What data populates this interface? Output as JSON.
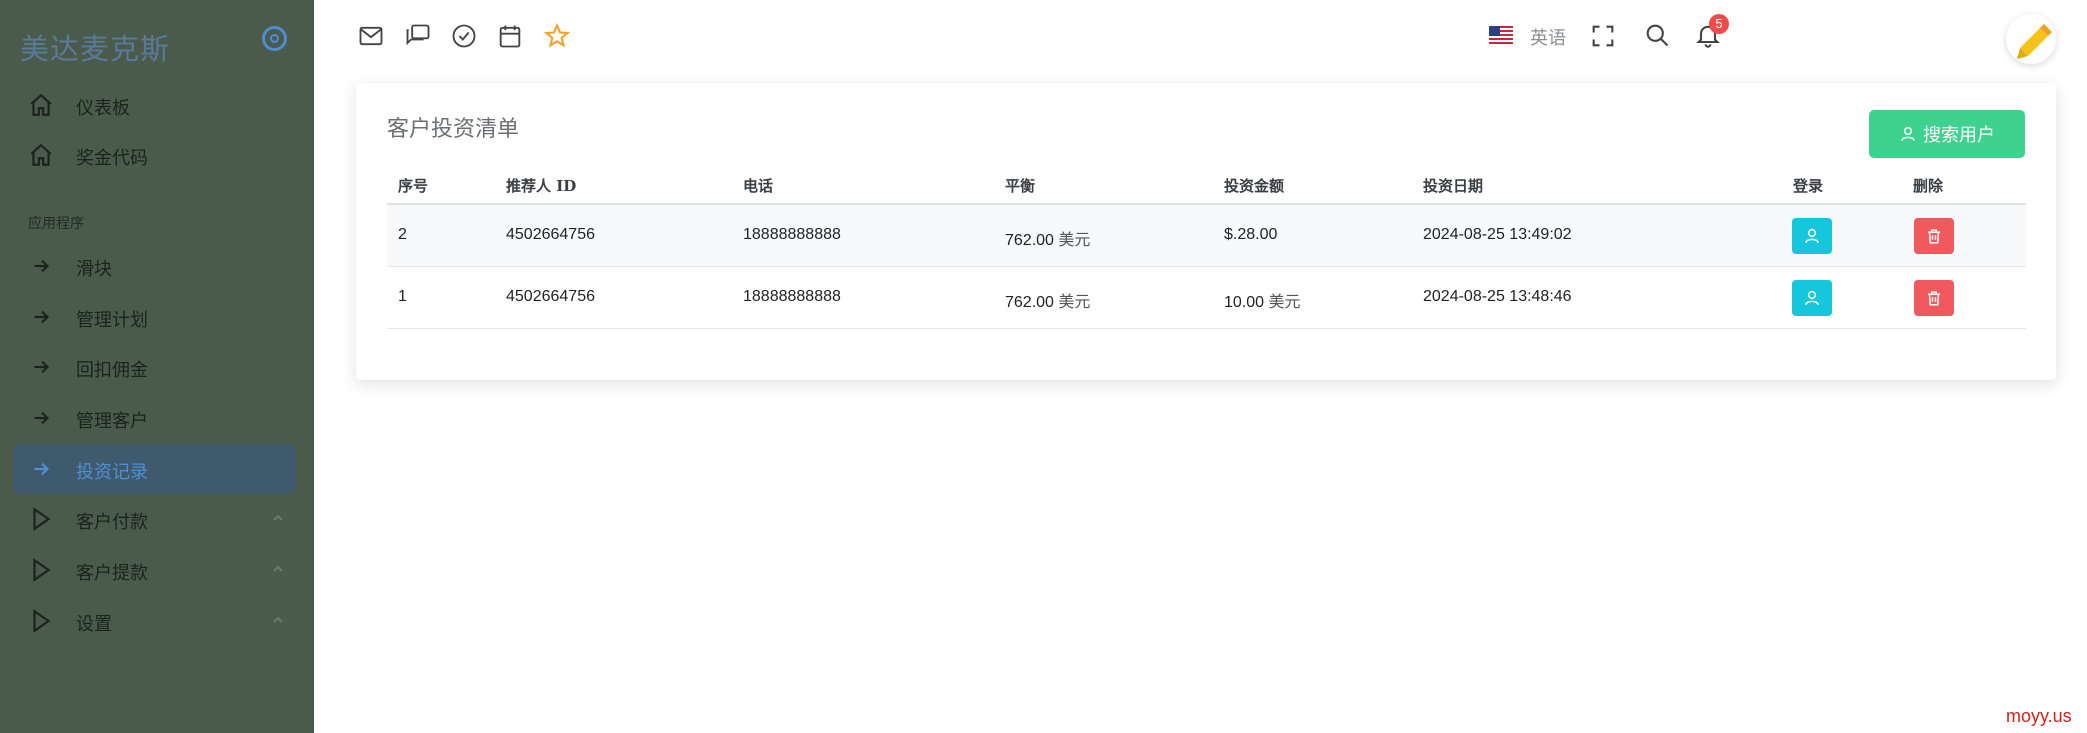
{
  "brand": {
    "name": "美达麦克斯"
  },
  "sidebar": {
    "section_title": "应用程序",
    "items": [
      {
        "label": "仪表板",
        "icon": "home-icon"
      },
      {
        "label": "奖金代码",
        "icon": "home-icon"
      },
      {
        "label": "滑块",
        "icon": "arrow-right-icon"
      },
      {
        "label": "管理计划",
        "icon": "arrow-right-icon"
      },
      {
        "label": "回扣佣金",
        "icon": "arrow-right-icon"
      },
      {
        "label": "管理客户",
        "icon": "arrow-right-icon"
      },
      {
        "label": "投资记录",
        "icon": "arrow-right-icon",
        "active": true
      },
      {
        "label": "客户付款",
        "icon": "play-icon"
      },
      {
        "label": "客户提款",
        "icon": "play-icon"
      },
      {
        "label": "设置",
        "icon": "play-icon"
      }
    ],
    "colors": {
      "background": "#4a5a4b",
      "active_bg": "#3f5a6c",
      "active_text": "#4f8fd6"
    }
  },
  "topbar": {
    "language": "英语",
    "notification_count": "5",
    "icons": [
      "mail-icon",
      "chat-icon",
      "check-circle-icon",
      "calendar-icon",
      "star-icon",
      "us-flag-icon",
      "fullscreen-icon",
      "search-icon",
      "bell-icon"
    ]
  },
  "card": {
    "title": "客户投资清单",
    "search_button": "搜索用户",
    "columns": [
      "序号",
      "推荐人 ID",
      "电话",
      "平衡",
      "投资金额",
      "投资日期",
      "登录",
      "删除"
    ],
    "rows": [
      {
        "no": "2",
        "referrer_id": "4502664756",
        "phone": "18888888888",
        "balance": "762.00",
        "balance_unit": "美元",
        "amount": "$.28.00",
        "amount_unit": "",
        "date": "2024-08-25 13:49:02"
      },
      {
        "no": "1",
        "referrer_id": "4502664756",
        "phone": "18888888888",
        "balance": "762.00",
        "balance_unit": "美元",
        "amount": "10.00",
        "amount_unit": "美元",
        "date": "2024-08-25 13:48:46"
      }
    ],
    "colors": {
      "search_button": "#3dd38e",
      "login_button": "#16c6dc",
      "delete_button": "#f0595e"
    }
  },
  "watermark": "moyy.us"
}
